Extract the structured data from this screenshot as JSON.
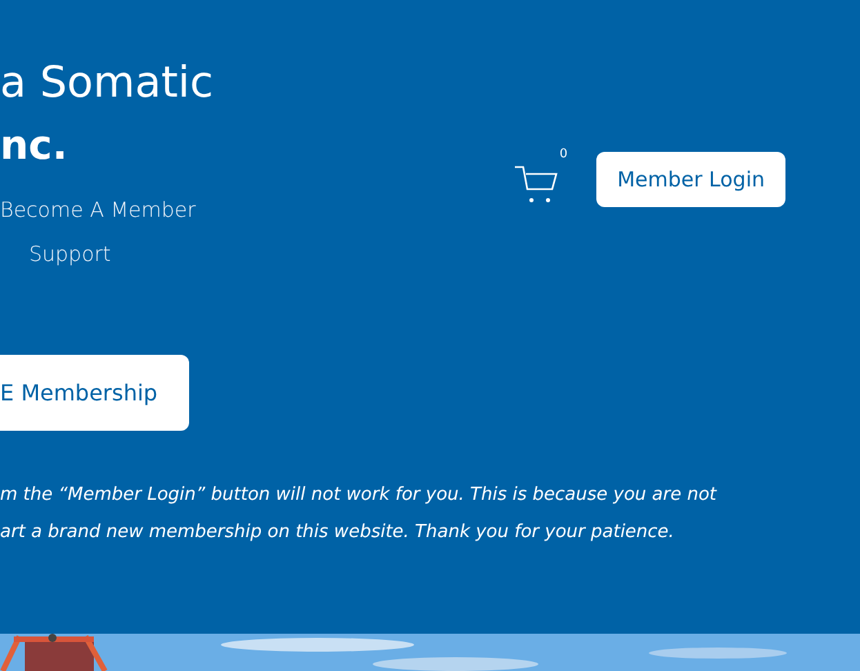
{
  "site_title": [
    "a Somatic",
    "nc."
  ],
  "nav": [
    {
      "label": "Become A Member"
    },
    {
      "label": "Support"
    }
  ],
  "cart": {
    "count": "0"
  },
  "login_button": "Member Login",
  "membership_button": "E Membership",
  "notice": [
    "m the “Member Login” button will not work for you. This is because you are not",
    "art a brand new membership on this website. Thank you for your patience."
  ]
}
